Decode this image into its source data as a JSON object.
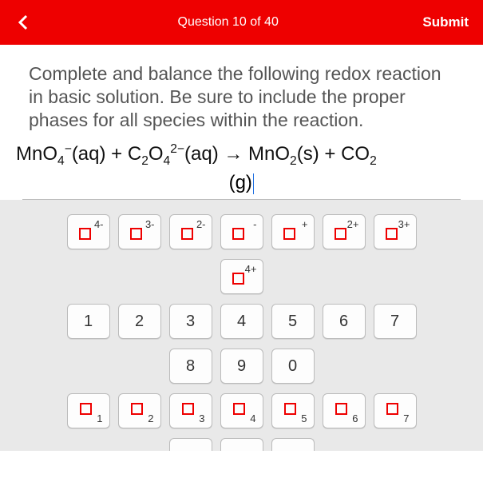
{
  "header": {
    "title": "Question 10 of 40",
    "submit": "Submit"
  },
  "prompt": "Complete and balance the following redox reaction in basic solution. Be sure to include the proper phases for all species within the reaction.",
  "equation": {
    "line1_html": "MnO<sub>4</sub><sup>−</sup>(aq) + C<sub>2</sub>O<sub>4</sub><sup>2−</sup>(aq) → MnO<sub>2</sub>(s) + CO<sub>2</sub>",
    "line2": "(g)"
  },
  "keypad": {
    "charge_row": [
      "4-",
      "3-",
      "2-",
      "-",
      "+",
      "2+",
      "3+"
    ],
    "charge_row2": [
      "4+"
    ],
    "digits_row1": [
      "1",
      "2",
      "3",
      "4",
      "5",
      "6",
      "7"
    ],
    "digits_row2": [
      "8",
      "9",
      "0"
    ],
    "sub_row": [
      "1",
      "2",
      "3",
      "4",
      "5",
      "6",
      "7"
    ]
  }
}
